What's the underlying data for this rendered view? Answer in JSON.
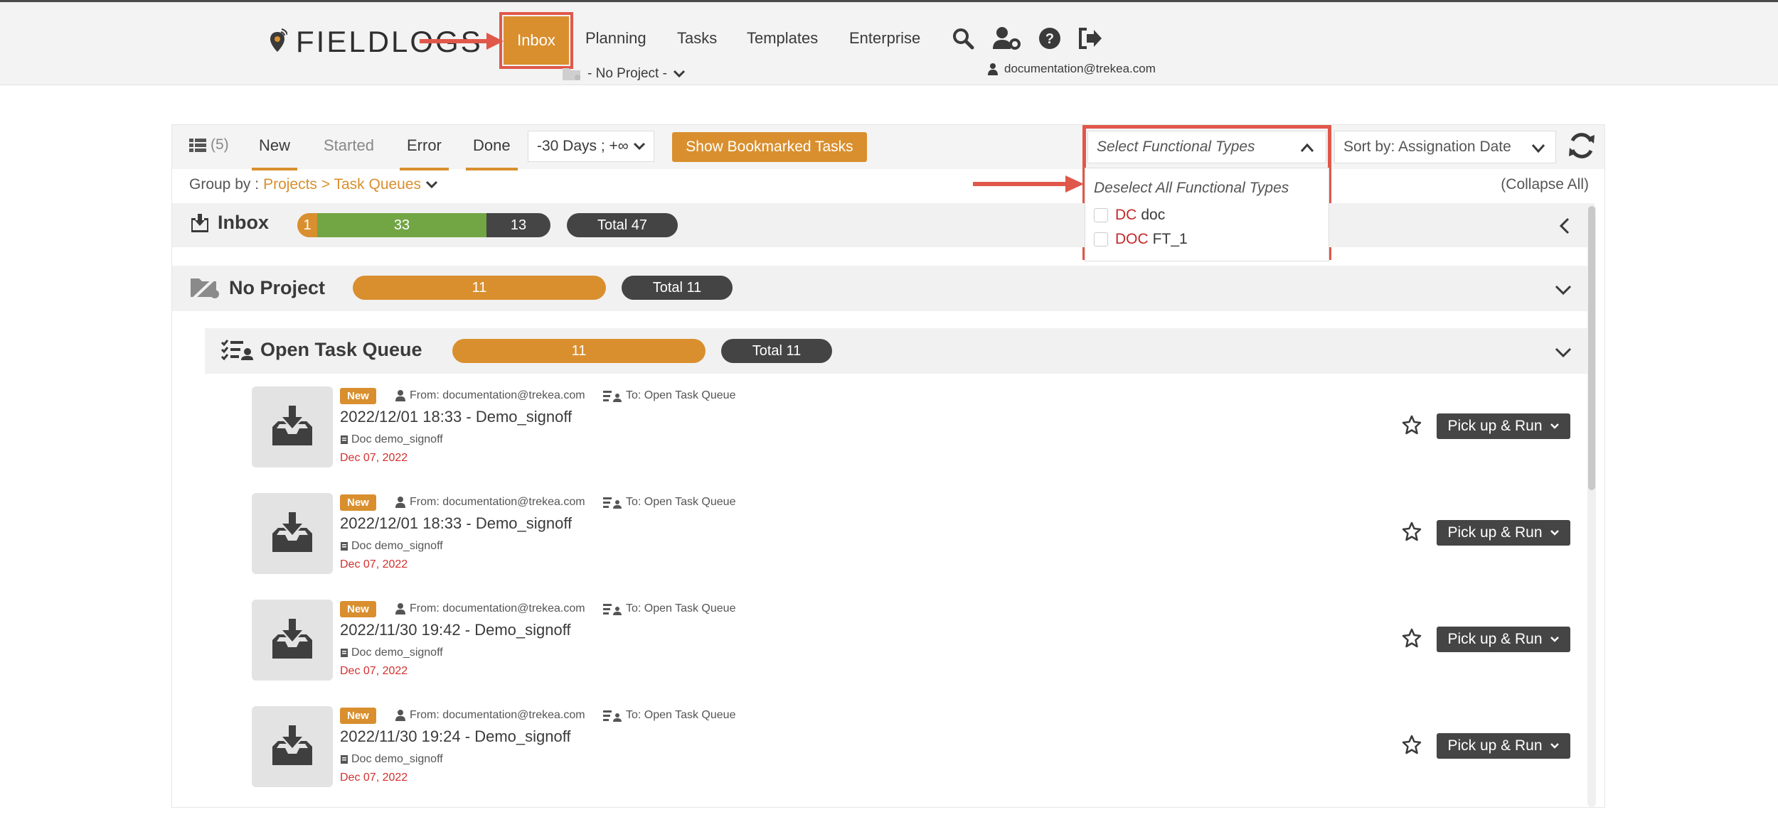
{
  "nav": {
    "logo": "FIELDLOGS",
    "inbox": "Inbox",
    "planning": "Planning",
    "tasks": "Tasks",
    "templates": "Templates",
    "enterprise": "Enterprise",
    "project_select": "- No Project -",
    "user_email": "documentation@trekea.com"
  },
  "toolbar": {
    "count": "(5)",
    "tab_new": "New",
    "tab_started": "Started",
    "tab_error": "Error",
    "tab_done": "Done",
    "date_range": "-30 Days ; +∞",
    "bookmark_button": "Show Bookmarked Tasks",
    "functional_types_placeholder": "Select Functional Types",
    "sort_by": "Sort by: Assignation Date"
  },
  "groupby": {
    "label": "Group by :",
    "value": "Projects > Task Queues",
    "collapse_all": "(Collapse All)"
  },
  "functional_types_dropdown": {
    "deselect_all": "Deselect All Functional Types",
    "options": [
      {
        "code": "DC",
        "name": "doc",
        "checked": false
      },
      {
        "code": "DOC",
        "name": "FT_1",
        "checked": false
      }
    ]
  },
  "groups": {
    "inbox": {
      "title": "Inbox",
      "bar": [
        {
          "value": "1",
          "color": "#d98f2e"
        },
        {
          "value": "33",
          "color": "#72a544"
        },
        {
          "value": "13",
          "color": "#454545"
        }
      ],
      "total": "Total 47"
    },
    "no_project": {
      "title": "No Project",
      "bar": [
        {
          "value": "11",
          "color": "#d98f2e"
        }
      ],
      "total": "Total 11"
    },
    "open_queue": {
      "title": "Open Task Queue",
      "bar": [
        {
          "value": "11",
          "color": "#d98f2e"
        }
      ],
      "total": "Total 11"
    }
  },
  "tasks": [
    {
      "status": "New",
      "from": "From: documentation@trekea.com",
      "to": "To: Open Task Queue",
      "title": "2022/12/01 18:33 - Demo_signoff",
      "doc": "Doc demo_signoff",
      "date": "Dec 07, 2022",
      "action": "Pick up & Run"
    },
    {
      "status": "New",
      "from": "From: documentation@trekea.com",
      "to": "To: Open Task Queue",
      "title": "2022/12/01 18:33 - Demo_signoff",
      "doc": "Doc demo_signoff",
      "date": "Dec 07, 2022",
      "action": "Pick up & Run"
    },
    {
      "status": "New",
      "from": "From: documentation@trekea.com",
      "to": "To: Open Task Queue",
      "title": "2022/11/30 19:42 - Demo_signoff",
      "doc": "Doc demo_signoff",
      "date": "Dec 07, 2022",
      "action": "Pick up & Run"
    },
    {
      "status": "New",
      "from": "From: documentation@trekea.com",
      "to": "To: Open Task Queue",
      "title": "2022/11/30 19:24 - Demo_signoff",
      "doc": "Doc demo_signoff",
      "date": "Dec 07, 2022",
      "action": "Pick up & Run"
    }
  ],
  "colors": {
    "accent": "#d98f2e",
    "success": "#72a544",
    "dark": "#454545",
    "annotation": "#e0584a",
    "date_red": "#d32f2f"
  }
}
